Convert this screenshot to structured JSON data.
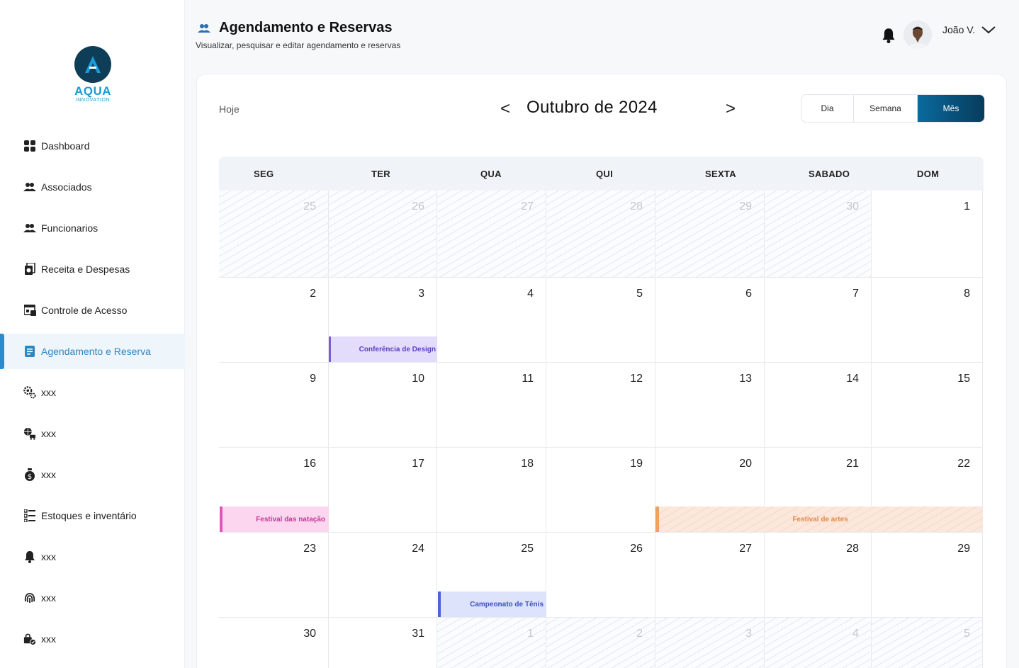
{
  "app": {
    "logo_name": "AQUA",
    "logo_sub": "INNOVATION"
  },
  "sidebar": {
    "items": [
      {
        "label": "Dashboard",
        "icon": "dashboard-icon"
      },
      {
        "label": "Associados",
        "icon": "users-icon"
      },
      {
        "label": "Funcionarios",
        "icon": "users-icon"
      },
      {
        "label": "Receita e Despesas",
        "icon": "money-icon"
      },
      {
        "label": "Controle de Acesso",
        "icon": "access-icon"
      },
      {
        "label": "Agendamento e Reserva",
        "icon": "schedule-icon",
        "active": true
      },
      {
        "label": "xxx",
        "icon": "gear-icon"
      },
      {
        "label": "xxx",
        "icon": "globe-icon"
      },
      {
        "label": "xxx",
        "icon": "money-bag-icon"
      },
      {
        "label": "Estoques e inventário",
        "icon": "list-icon"
      },
      {
        "label": "xxx",
        "icon": "bell-icon"
      },
      {
        "label": "xxx",
        "icon": "fingerprint-icon"
      },
      {
        "label": "xxx",
        "icon": "lock-check-icon"
      }
    ]
  },
  "header": {
    "title": "Agendamento e Reservas",
    "subtitle": "Visualizar, pesquisar e editar agendamento e reservas",
    "user_name": "João V."
  },
  "calendar": {
    "today_label": "Hoje",
    "prev_label": "<",
    "next_label": ">",
    "month_title": "Outubro de 2024",
    "views": [
      "Dia",
      "Semana",
      "Mês"
    ],
    "active_view": "Mês",
    "weekdays": [
      "SEG",
      "TER",
      "QUA",
      "QUI",
      "SEXTA",
      "SABADO",
      "DOM"
    ],
    "weeks": [
      [
        "25",
        "26",
        "27",
        "28",
        "29",
        "30",
        "1"
      ],
      [
        "2",
        "3",
        "4",
        "5",
        "6",
        "7",
        "8"
      ],
      [
        "9",
        "10",
        "11",
        "12",
        "13",
        "14",
        "15"
      ],
      [
        "16",
        "17",
        "18",
        "19",
        "20",
        "21",
        "22"
      ],
      [
        "23",
        "24",
        "25",
        "26",
        "27",
        "28",
        "29"
      ],
      [
        "30",
        "31",
        "1",
        "2",
        "3",
        "4",
        "5"
      ]
    ],
    "events": [
      {
        "label": "Conferência de Design",
        "color": "#7b5cd6"
      },
      {
        "label": "Festival das natação",
        "color": "#e055b5"
      },
      {
        "label": "Festival de artes",
        "color": "#f2a05e"
      },
      {
        "label": "Campeonato de Tênis",
        "color": "#4a66d6"
      }
    ]
  },
  "colors": {
    "accent": "#2a8ad0",
    "active_view_bg": "#0a6a9e",
    "sidebar_active_bg": "#eef6fc"
  }
}
